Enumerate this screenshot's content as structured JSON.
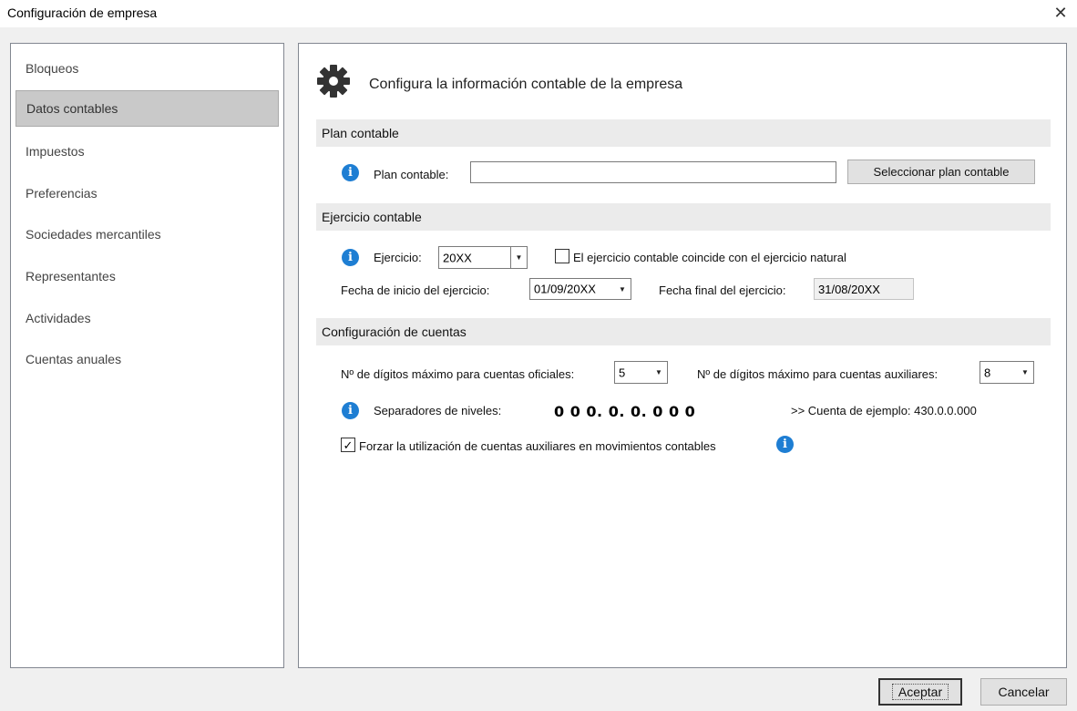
{
  "window": {
    "title": "Configuración de empresa",
    "close_glyph": "✕"
  },
  "sidebar": {
    "items": [
      {
        "label": "Bloqueos"
      },
      {
        "label": "Datos contables"
      },
      {
        "label": "Impuestos"
      },
      {
        "label": "Preferencias"
      },
      {
        "label": "Sociedades mercantiles"
      },
      {
        "label": "Representantes"
      },
      {
        "label": "Actividades"
      },
      {
        "label": "Cuentas anuales"
      }
    ],
    "active_item": "Datos contables"
  },
  "main": {
    "icon": "gear-icon",
    "heading": "Configura la información contable de la empresa",
    "plan": {
      "section_title": "Plan contable",
      "label": "Plan contable:",
      "value": "",
      "button_label": "Seleccionar plan contable"
    },
    "ejercicio": {
      "section_title": "Ejercicio contable",
      "ejercicio_label": "Ejercicio:",
      "ejercicio_value": "20XX",
      "checkbox_label": "El ejercicio contable coincide con el ejercicio natural",
      "checkbox_checked": false,
      "fecha_inicio_label": "Fecha de inicio del ejercicio:",
      "fecha_inicio_value": "01/09/20XX",
      "fecha_final_label": "Fecha final del ejercicio:",
      "fecha_final_value": "31/08/20XX"
    },
    "cuentas": {
      "section_title": "Configuración de cuentas",
      "oficiales_label": "Nº de dígitos máximo para cuentas oficiales:",
      "oficiales_value": "5",
      "auxiliares_label": "Nº de dígitos máximo para cuentas auxiliares:",
      "auxiliares_value": "8",
      "separadores_label": "Separadores de niveles:",
      "separadores_value": "0 0 0. 0. 0. 0 0 0",
      "ejemplo_label": ">> Cuenta de ejemplo: 430.0.0.000",
      "forzar_label": "Forzar la utilización de cuentas auxiliares en movimientos contables",
      "forzar_checked": true
    }
  },
  "footer": {
    "accept_label": "Aceptar",
    "cancel_label": "Cancelar"
  },
  "colors": {
    "info_blue": "#1e7ed3",
    "selected_item": "#c9c9c9",
    "section_header": "#ebebeb"
  }
}
